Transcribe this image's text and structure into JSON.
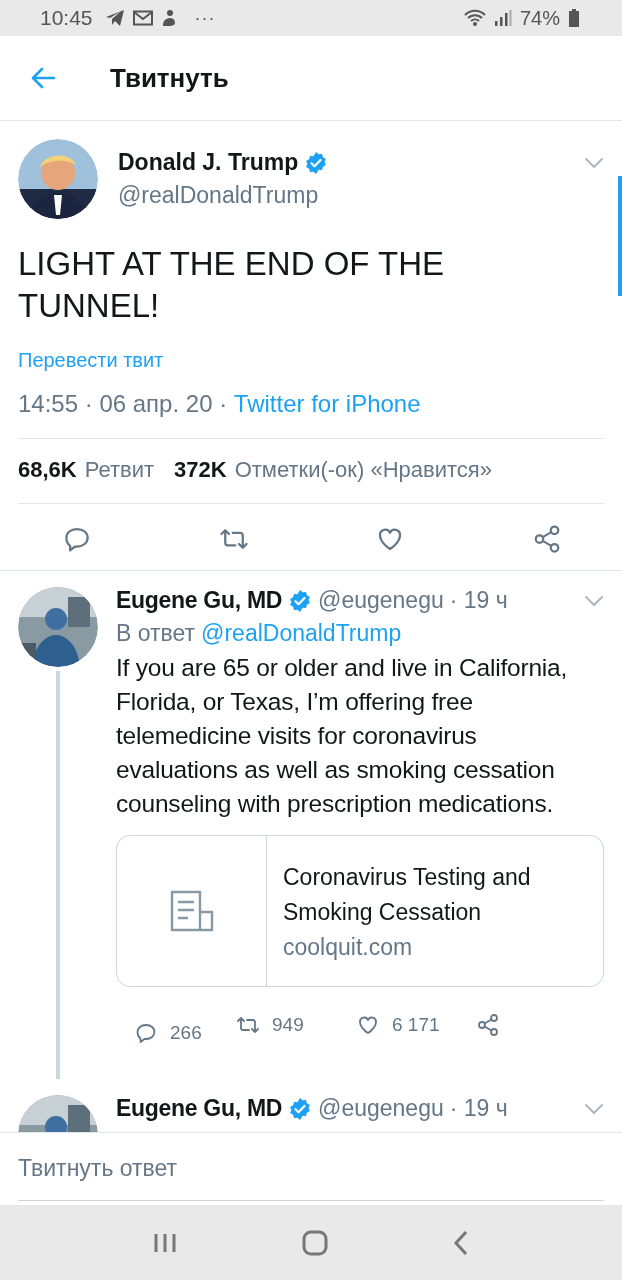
{
  "status_bar": {
    "time": "10:45",
    "more": "···",
    "battery": "74%"
  },
  "header": {
    "title": "Твитнуть"
  },
  "tweet": {
    "author": "Donald J. Trump",
    "verified": true,
    "handle": "@realDonaldTrump",
    "text": "LIGHT AT THE END OF THE TUNNEL!",
    "translate": "Перевести твит",
    "time": "14:55 · 06 апр. 20 · ",
    "source": "Twitter for iPhone",
    "stats": [
      {
        "count": "68,6K",
        "label": "Ретвит"
      },
      {
        "count": "372K",
        "label": "Отметки(-ок) «Нравится»"
      }
    ]
  },
  "replies": [
    {
      "author": "Eugene Gu, MD",
      "verified": true,
      "handle": "@eugenegu",
      "age": "· 19 ч",
      "reply_to_label": "В ответ",
      "reply_to": "@realDonaldTrump",
      "thread_line": true,
      "text": "If you are 65 or older and live in California, Florida, or Texas, I’m offering free telemedicine visits for coronavirus evaluations as well as smoking cessation counseling with prescription medications.",
      "card": {
        "title": "Coronavirus Testing and Smoking Cessation",
        "domain": "coolquit.com"
      },
      "actions": [
        {
          "kind": "reply",
          "count": "266"
        },
        {
          "kind": "retweet",
          "count": "949"
        },
        {
          "kind": "like",
          "count": "6 171"
        },
        {
          "kind": "share"
        }
      ]
    },
    {
      "author": "Eugene Gu, MD",
      "verified": true,
      "handle": "@eugenegu",
      "age": "· 19 ч",
      "thread_line": false
    }
  ],
  "reply_bar": {
    "placeholder": "Твитнуть ответ"
  }
}
